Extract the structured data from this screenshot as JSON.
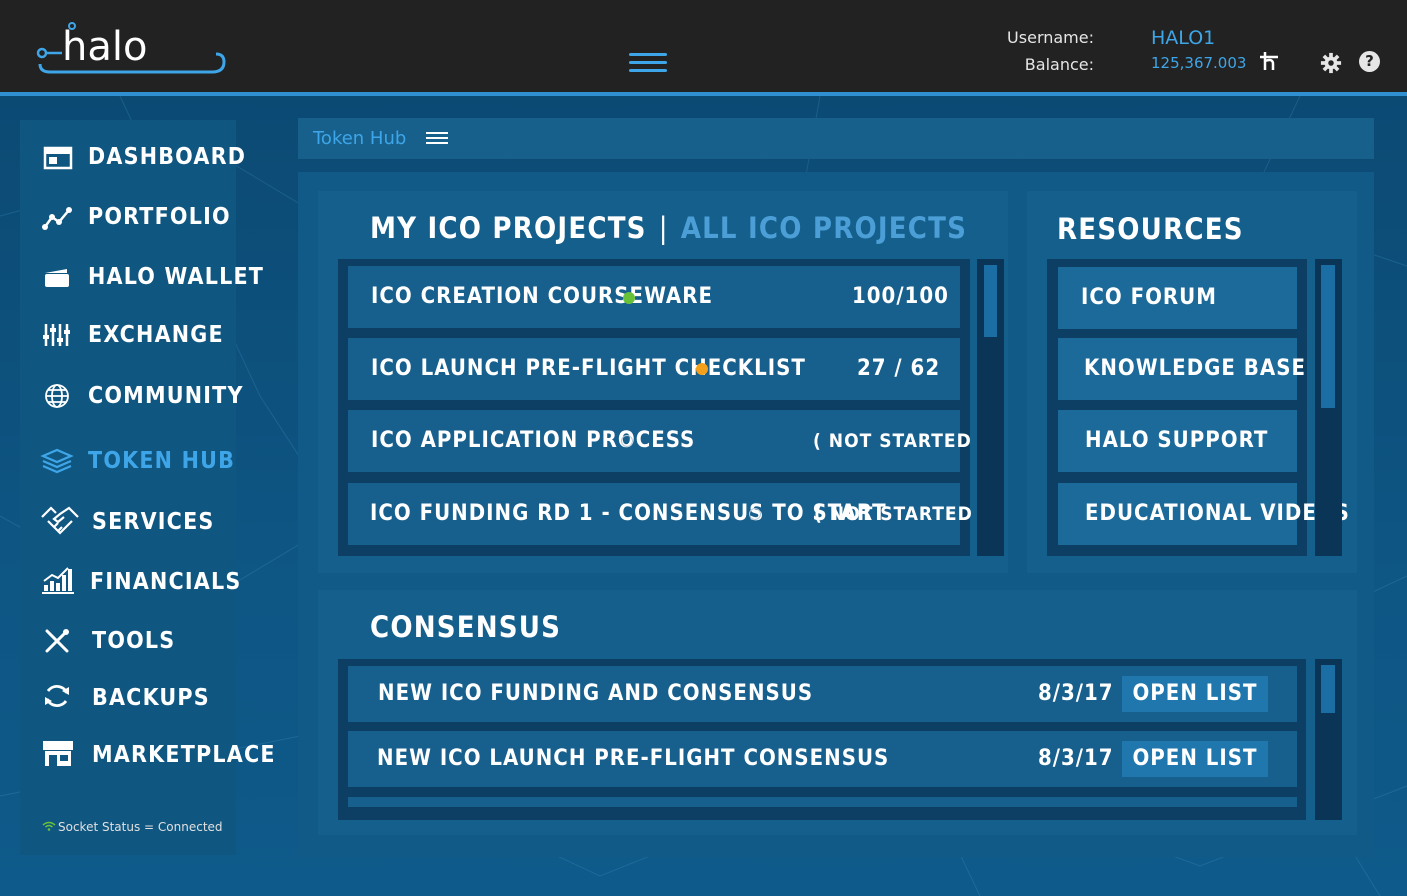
{
  "header": {
    "logo_text": "halo",
    "username_label": "Username:",
    "balance_label": "Balance:",
    "username": "HALO1",
    "balance": "125,367.003",
    "currency_icon": "halo-coin-icon",
    "settings_icon": "gear-icon",
    "help_icon": "help-icon",
    "help_glyph": "?"
  },
  "sidebar": {
    "items": [
      {
        "label": "DASHBOARD",
        "icon": "dashboard-icon"
      },
      {
        "label": "PORTFOLIO",
        "icon": "portfolio-icon"
      },
      {
        "label": "HALO WALLET",
        "icon": "wallet-icon"
      },
      {
        "label": "EXCHANGE",
        "icon": "exchange-icon"
      },
      {
        "label": "COMMUNITY",
        "icon": "globe-icon"
      },
      {
        "label": "TOKEN HUB",
        "icon": "layers-icon",
        "active": true
      },
      {
        "label": "SERVICES",
        "icon": "handshake-icon"
      },
      {
        "label": "FINANCIALS",
        "icon": "financials-icon"
      },
      {
        "label": "TOOLS",
        "icon": "tools-icon"
      },
      {
        "label": "BACKUPS",
        "icon": "refresh-icon"
      },
      {
        "label": "MARKETPLACE",
        "icon": "store-icon"
      }
    ],
    "socket_status": "Socket Status = Connected"
  },
  "breadcrumb": {
    "title": "Token Hub"
  },
  "ico": {
    "tab_mine": "MY ICO PROJECTS",
    "separator": "|",
    "tab_all": "ALL ICO PROJECTS",
    "projects": [
      {
        "name": "ICO CREATION COURSEWARE",
        "status": "complete",
        "status_color": "#67c23a",
        "progress": "100/100"
      },
      {
        "name": "ICO LAUNCH PRE-FLIGHT CHECKLIST",
        "status": "in-progress",
        "status_color": "#f5a01a",
        "progress": "27 / 62"
      },
      {
        "name": "ICO APPLICATION PROCESS",
        "status": "not-started",
        "progress": "( NOT STARTED )"
      },
      {
        "name": "ICO FUNDING RD 1 - CONSENSUS TO START",
        "status": "not-started",
        "progress": "( NOT STARTED )"
      }
    ]
  },
  "resources": {
    "title": "RESOURCES",
    "items": [
      "ICO FORUM",
      "KNOWLEDGE BASE",
      "HALO SUPPORT",
      "EDUCATIONAL VIDEOS"
    ]
  },
  "consensus": {
    "title": "CONSENSUS",
    "items": [
      {
        "name": "NEW ICO FUNDING AND CONSENSUS",
        "date": "8/3/17",
        "action": "OPEN LIST"
      },
      {
        "name": "NEW ICO LAUNCH PRE-FLIGHT CONSENSUS",
        "date": "8/3/17",
        "action": "OPEN LIST"
      }
    ]
  },
  "colors": {
    "accent": "#3ea6e8",
    "topbar": "#222222",
    "background": "#0d4670",
    "complete_dot": "#67c23a",
    "progress_dot": "#f5a01a"
  }
}
